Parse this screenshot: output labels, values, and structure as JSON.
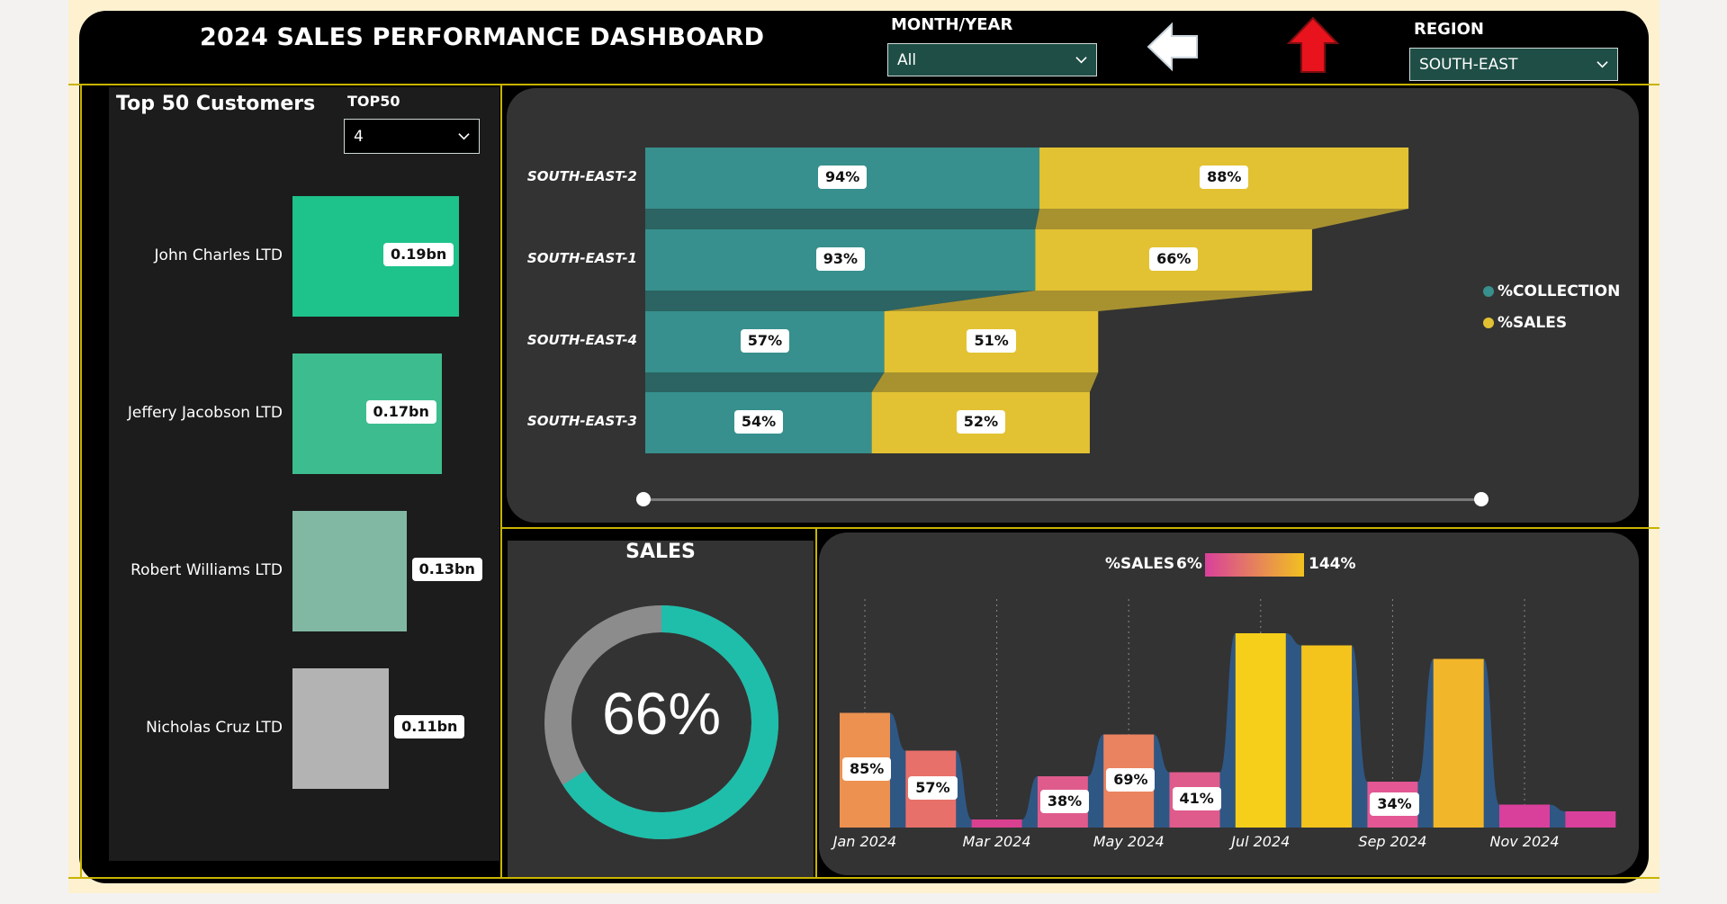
{
  "header": {
    "title": "2024 SALES PERFORMANCE DASHBOARD",
    "month_year_label": "MONTH/YEAR",
    "month_year_value": "All",
    "region_label": "REGION",
    "region_value": "SOUTH-EAST",
    "back_icon": "left-arrow-icon",
    "up_icon": "up-arrow-icon",
    "colors": {
      "back_arrow": "#ffffff",
      "up_arrow": "#e8131c",
      "dropdown_bg": "#1f4e46"
    }
  },
  "customers": {
    "title": "Top 50 Customers",
    "top_label": "TOP50",
    "top_value": "4",
    "chart_data": {
      "type": "bar",
      "categories": [
        "John Charles LTD",
        "Jeffery Jacobson LTD",
        "Robert Williams LTD",
        "Nicholas Cruz LTD"
      ],
      "values": [
        0.19,
        0.17,
        0.13,
        0.11
      ],
      "labels": [
        "0.19bn",
        "0.17bn",
        "0.13bn",
        "0.11bn"
      ],
      "colors": [
        "#1ec28b",
        "#3dbd8f",
        "#80b8a3",
        "#b3b3b3"
      ]
    }
  },
  "region_chart": {
    "chart_data": {
      "type": "bar",
      "categories": [
        "SOUTH-EAST-2",
        "SOUTH-EAST-1",
        "SOUTH-EAST-4",
        "SOUTH-EAST-3"
      ],
      "series": [
        {
          "name": "%COLLECTION",
          "values": [
            94,
            93,
            57,
            54
          ],
          "labels": [
            "94%",
            "93%",
            "57%",
            "54%"
          ],
          "color": "#37908d"
        },
        {
          "name": "%SALES",
          "values": [
            88,
            66,
            51,
            52
          ],
          "labels": [
            "88%",
            "66%",
            "51%",
            "52%"
          ],
          "color": "#e2c233"
        }
      ]
    }
  },
  "sales_gauge": {
    "title": "SALES",
    "value_label": "66%",
    "value": 66,
    "colors": {
      "fill": "#1ebeaa",
      "rest": "#8c8c8c"
    }
  },
  "monthly": {
    "legend_label": "%SALES",
    "legend_min": "6%",
    "legend_max": "144%",
    "chart_data": {
      "type": "bar",
      "x_ticks": [
        "Jan 2024",
        "Mar 2024",
        "May 2024",
        "Jul 2024",
        "Sep 2024",
        "Nov 2024"
      ],
      "categories": [
        "Jan 2024",
        "Feb 2024",
        "Mar 2024",
        "Apr 2024",
        "May 2024",
        "Jun 2024",
        "Jul 2024",
        "Aug 2024",
        "Sep 2024",
        "Oct 2024",
        "Nov 2024",
        "Dec 2024"
      ],
      "values": [
        85,
        57,
        6,
        38,
        69,
        41,
        144,
        135,
        34,
        125,
        17,
        12
      ],
      "labels": [
        "85%",
        "57%",
        "",
        "38%",
        "69%",
        "41%",
        "",
        "",
        "34%",
        "",
        "",
        ""
      ],
      "colors": [
        "#ec9150",
        "#e8706a",
        "#d9408f",
        "#df5b8c",
        "#ea8360",
        "#df5b8c",
        "#f6cf1b",
        "#f4c41d",
        "#e35795",
        "#f1b62a",
        "#d9409b",
        "#d9409b"
      ]
    }
  }
}
